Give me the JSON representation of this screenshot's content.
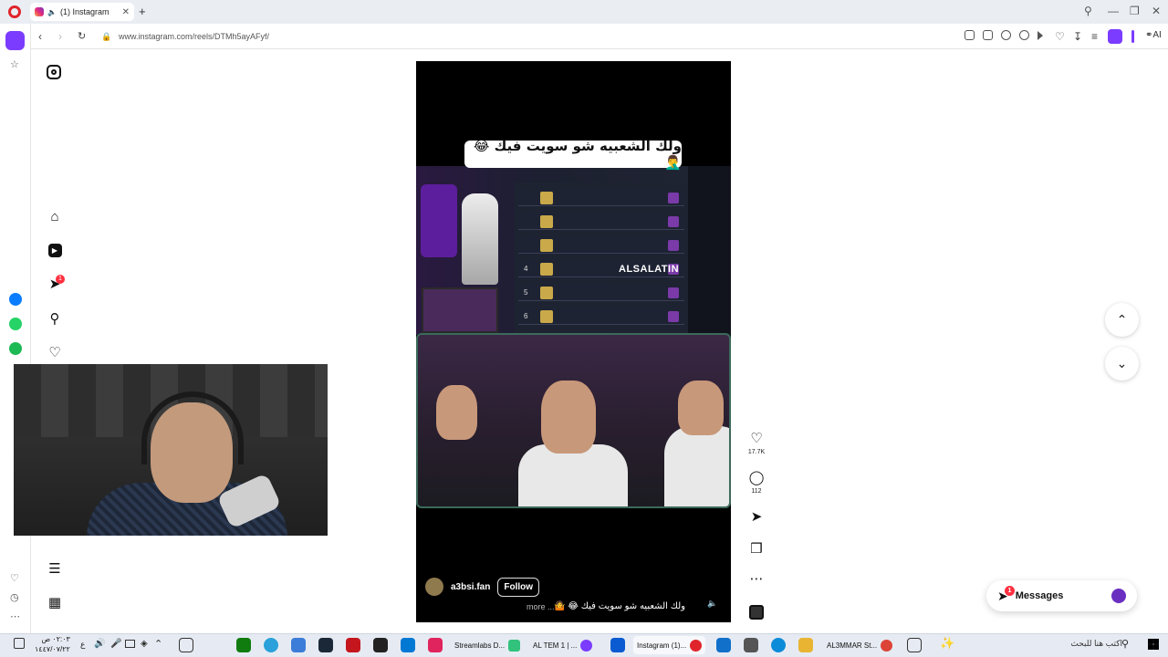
{
  "browser": {
    "tab_title": "(1) Instagram",
    "new_tab": "+",
    "url": "www.instagram.com/reels/DTMh5ayAFyf/",
    "ai_label": "AI",
    "window_controls": [
      "—",
      "❐",
      "✕"
    ]
  },
  "reel": {
    "overlay_caption": "ولك الشعبيه شو سويت فيك 😂🤦‍♂️",
    "game_watermark": "ALSALATIN",
    "username": "a3bsi.fan",
    "follow_label": "Follow",
    "caption": "ولك الشعبيه شو سويت فيك 😂 🤷",
    "more_label": "more ...",
    "leaderboard_ranks": [
      "",
      "",
      "",
      "4",
      "5",
      "6"
    ],
    "likes": "17.7K",
    "comments": "112"
  },
  "messages": {
    "label": "Messages",
    "badge": "1"
  },
  "notifications_badge": "1",
  "taskbar": {
    "search_placeholder": "اكتب هنا للبحث",
    "items": [
      {
        "label": "AL3MMAR St...",
        "color": "#e0242b"
      },
      {
        "label": "Instagram (1)...",
        "color": "#e0242b"
      },
      {
        "label": "AL TEM 1 | ...",
        "color": "#7b3cff"
      },
      {
        "label": "Streamlabs D...",
        "color": "#31c27c"
      }
    ],
    "clock_time": "٠٢:٠٣ ص",
    "clock_date": "١٤٤٧/٠٧/٢٢",
    "lang": "ع"
  }
}
